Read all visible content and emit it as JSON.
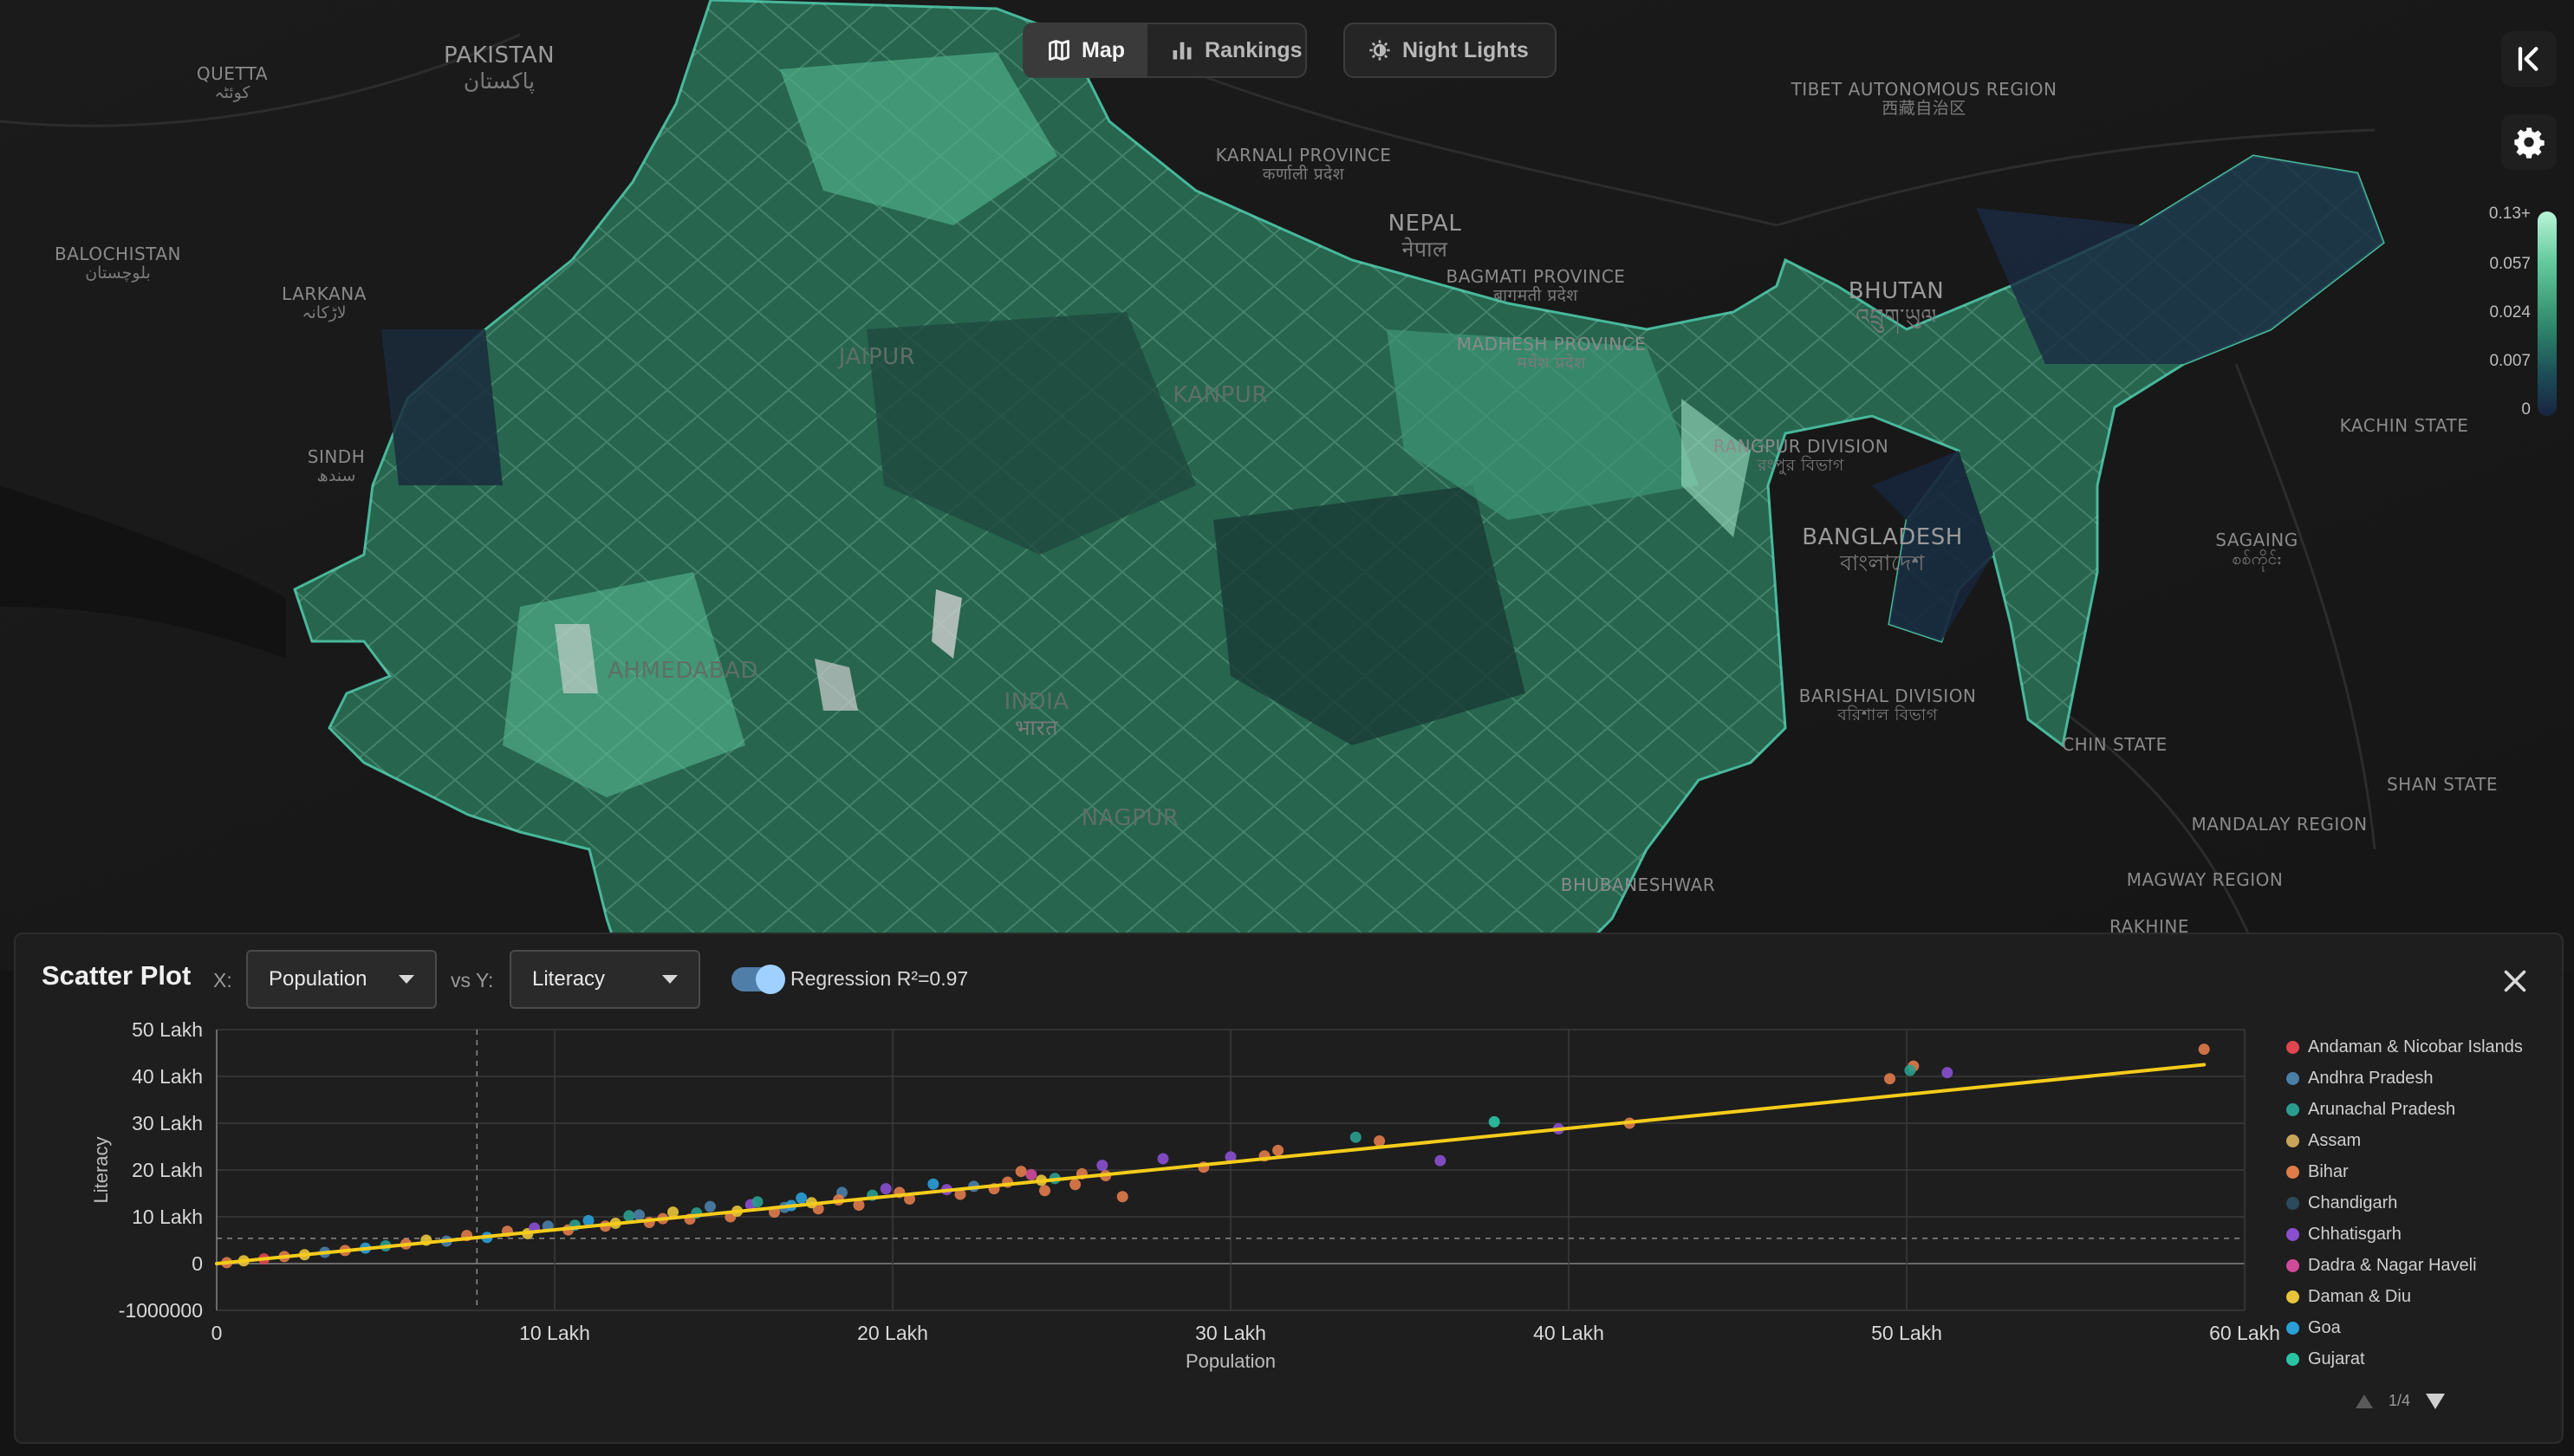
{
  "toolbar": {
    "modes": [
      {
        "label": "Map",
        "icon": "map-icon",
        "active": true
      },
      {
        "label": "Rankings",
        "icon": "bar-chart-icon",
        "active": false
      }
    ],
    "night_lights_label": "Night Lights",
    "night_lights_icon": "night-lights-icon"
  },
  "controls": {
    "collapse_icon": "collapse-panel-icon",
    "settings_icon": "gear-icon"
  },
  "map": {
    "color_scale": {
      "ticks": [
        "0.13+",
        "0.057",
        "0.024",
        "0.007",
        "0"
      ],
      "colors": [
        "#b8f5d8",
        "#63c99c",
        "#2f8a6c",
        "#1c4d56",
        "#182440"
      ]
    },
    "labels": [
      {
        "id": "pakistan",
        "text": "PAKISTAN",
        "sub": "پاکستان"
      },
      {
        "id": "quetta",
        "text": "QUETTA",
        "sub": "کوئٹہ"
      },
      {
        "id": "balochistan",
        "text": "BALOCHISTAN",
        "sub": "بلوچستان"
      },
      {
        "id": "larkana",
        "text": "LARKANA",
        "sub": "لاڑکانہ"
      },
      {
        "id": "sindh",
        "text": "SINDH",
        "sub": "سندھ"
      },
      {
        "id": "tibet",
        "text": "TIBET AUTONOMOUS REGION",
        "sub": "西藏自治区"
      },
      {
        "id": "karnali",
        "text": "KARNALI PROVINCE",
        "sub": "कर्णाली प्रदेश"
      },
      {
        "id": "nepal",
        "text": "NEPAL",
        "sub": "नेपाल"
      },
      {
        "id": "bagmati",
        "text": "BAGMATI PROVINCE",
        "sub": "बागमती प्रदेश"
      },
      {
        "id": "madhesh",
        "text": "MADHESH PROVINCE",
        "sub": "मधेश प्रदेश"
      },
      {
        "id": "bhutan",
        "text": "BHUTAN",
        "sub": "འབྲུག་ཡུལ"
      },
      {
        "id": "rangpur",
        "text": "RANGPUR DIVISION",
        "sub": "রংপুর বিভাগ"
      },
      {
        "id": "bangladesh",
        "text": "BANGLADESH",
        "sub": "বাংলাদেশ"
      },
      {
        "id": "barishal",
        "text": "BARISHAL DIVISION",
        "sub": "বরিশাল বিভাগ"
      },
      {
        "id": "kachin",
        "text": "KACHIN STATE",
        "sub": ""
      },
      {
        "id": "sagaing",
        "text": "SAGAING",
        "sub": "စစ်ကိုင်း"
      },
      {
        "id": "chin",
        "text": "CHIN STATE",
        "sub": ""
      },
      {
        "id": "shan",
        "text": "SHAN STATE",
        "sub": ""
      },
      {
        "id": "mandalay",
        "text": "MANDALAY REGION",
        "sub": ""
      },
      {
        "id": "magway",
        "text": "MAGWAY REGION",
        "sub": ""
      },
      {
        "id": "rakhine",
        "text": "RAKHINE",
        "sub": ""
      },
      {
        "id": "bhubaneshwar",
        "text": "BHUBANESHWAR",
        "sub": ""
      },
      {
        "id": "india",
        "text": "INDIA",
        "sub": "भारत"
      },
      {
        "id": "jaipur",
        "text": "JAIPUR",
        "sub": ""
      },
      {
        "id": "kanpur",
        "text": "KANPUR",
        "sub": ""
      },
      {
        "id": "ahmedabad",
        "text": "AHMEDABAD",
        "sub": ""
      },
      {
        "id": "nagpur",
        "text": "NAGPUR",
        "sub": ""
      }
    ]
  },
  "scatter": {
    "title": "Scatter Plot",
    "x_label": "X:",
    "x_value": "Population",
    "vs_label": "vs Y:",
    "y_value": "Literacy",
    "regression_enabled": true,
    "regression_label": "Regression R²=0.97",
    "close_icon": "close-icon",
    "legend": [
      {
        "name": "Andaman & Nicobar Islands",
        "color": "#e0464f"
      },
      {
        "name": "Andhra Pradesh",
        "color": "#4a7fa8"
      },
      {
        "name": "Arunachal Pradesh",
        "color": "#2a9d8f"
      },
      {
        "name": "Assam",
        "color": "#c8a45a"
      },
      {
        "name": "Bihar",
        "color": "#e07b4a"
      },
      {
        "name": "Chandigarh",
        "color": "#2c4a5e"
      },
      {
        "name": "Chhatisgarh",
        "color": "#8a4fd0"
      },
      {
        "name": "Dadra & Nagar Haveli",
        "color": "#d04a9a"
      },
      {
        "name": "Daman & Diu",
        "color": "#e8c43a"
      },
      {
        "name": "Goa",
        "color": "#2a9fd8"
      },
      {
        "name": "Gujarat",
        "color": "#2ac4a4"
      }
    ],
    "legend_page": "1/4"
  },
  "chart_data": {
    "type": "scatter",
    "xlabel": "Population",
    "ylabel": "Literacy",
    "x_ticks": [
      "0",
      "10 Lakh",
      "20 Lakh",
      "30 Lakh",
      "40 Lakh",
      "50 Lakh",
      "60 Lakh"
    ],
    "y_ticks": [
      "50 Lakh",
      "40 Lakh",
      "30 Lakh",
      "20 Lakh",
      "10 Lakh",
      "0",
      "-1000000"
    ],
    "xlim": [
      0,
      6000000
    ],
    "ylim": [
      -1000000,
      5000000
    ],
    "regression": {
      "r2": 0.97,
      "start": [
        0,
        0
      ],
      "end": [
        5880000,
        4250000
      ],
      "color": "#f5cc1a"
    },
    "reference_lines": {
      "x": 770000,
      "y": 540000
    },
    "points": [
      [
        5880000,
        4580000,
        4
      ],
      [
        5020000,
        4220000,
        4
      ],
      [
        4950000,
        3950000,
        4
      ],
      [
        5010000,
        4130000,
        2
      ],
      [
        5120000,
        4080000,
        6
      ],
      [
        4180000,
        3000000,
        4
      ],
      [
        3970000,
        2880000,
        6
      ],
      [
        3780000,
        3030000,
        10
      ],
      [
        3620000,
        2200000,
        6
      ],
      [
        3440000,
        2620000,
        4
      ],
      [
        3370000,
        2700000,
        2
      ],
      [
        3140000,
        2420000,
        4
      ],
      [
        3100000,
        2300000,
        4
      ],
      [
        3000000,
        2280000,
        6
      ],
      [
        2920000,
        2060000,
        4
      ],
      [
        2800000,
        2240000,
        6
      ],
      [
        2680000,
        1430000,
        4
      ],
      [
        2630000,
        1880000,
        4
      ],
      [
        2620000,
        2100000,
        6
      ],
      [
        2540000,
        1690000,
        4
      ],
      [
        2480000,
        1820000,
        2
      ],
      [
        2450000,
        1560000,
        4
      ],
      [
        2410000,
        1900000,
        7
      ],
      [
        2380000,
        1970000,
        4
      ],
      [
        2300000,
        1600000,
        4
      ],
      [
        2200000,
        1480000,
        4
      ],
      [
        2120000,
        1700000,
        9
      ],
      [
        2050000,
        1380000,
        4
      ],
      [
        1980000,
        1600000,
        6
      ],
      [
        1900000,
        1250000,
        4
      ],
      [
        1850000,
        1520000,
        1
      ],
      [
        1780000,
        1170000,
        4
      ],
      [
        1730000,
        1400000,
        9
      ],
      [
        1650000,
        1100000,
        4
      ],
      [
        1580000,
        1260000,
        6
      ],
      [
        1520000,
        1000000,
        4
      ],
      [
        1460000,
        1220000,
        1
      ],
      [
        1400000,
        950000,
        4
      ],
      [
        1350000,
        1100000,
        8
      ],
      [
        1280000,
        880000,
        4
      ],
      [
        1220000,
        1020000,
        2
      ],
      [
        1150000,
        800000,
        4
      ],
      [
        1100000,
        920000,
        9
      ],
      [
        1040000,
        720000,
        4
      ],
      [
        980000,
        800000,
        1
      ],
      [
        920000,
        640000,
        8
      ],
      [
        860000,
        690000,
        4
      ],
      [
        800000,
        560000,
        9
      ],
      [
        740000,
        600000,
        4
      ],
      [
        680000,
        480000,
        1
      ],
      [
        620000,
        500000,
        8
      ],
      [
        560000,
        420000,
        4
      ],
      [
        500000,
        380000,
        2
      ],
      [
        440000,
        330000,
        9
      ],
      [
        380000,
        280000,
        4
      ],
      [
        320000,
        240000,
        1
      ],
      [
        260000,
        190000,
        8
      ],
      [
        200000,
        150000,
        4
      ],
      [
        140000,
        100000,
        0
      ],
      [
        80000,
        60000,
        8
      ],
      [
        30000,
        20000,
        4
      ],
      [
        1680000,
        1200000,
        1
      ],
      [
        1600000,
        1320000,
        2
      ],
      [
        1540000,
        1120000,
        8
      ],
      [
        1320000,
        960000,
        4
      ],
      [
        1250000,
        1040000,
        1
      ],
      [
        1180000,
        860000,
        8
      ],
      [
        1060000,
        820000,
        2
      ],
      [
        940000,
        760000,
        6
      ],
      [
        1760000,
        1300000,
        8
      ],
      [
        1840000,
        1360000,
        4
      ],
      [
        1940000,
        1460000,
        2
      ],
      [
        2020000,
        1520000,
        4
      ],
      [
        2160000,
        1580000,
        6
      ],
      [
        2240000,
        1650000,
        1
      ],
      [
        2340000,
        1740000,
        4
      ],
      [
        2440000,
        1780000,
        8
      ],
      [
        2560000,
        1920000,
        4
      ],
      [
        1420000,
        1080000,
        2
      ],
      [
        1700000,
        1240000,
        9
      ]
    ]
  }
}
